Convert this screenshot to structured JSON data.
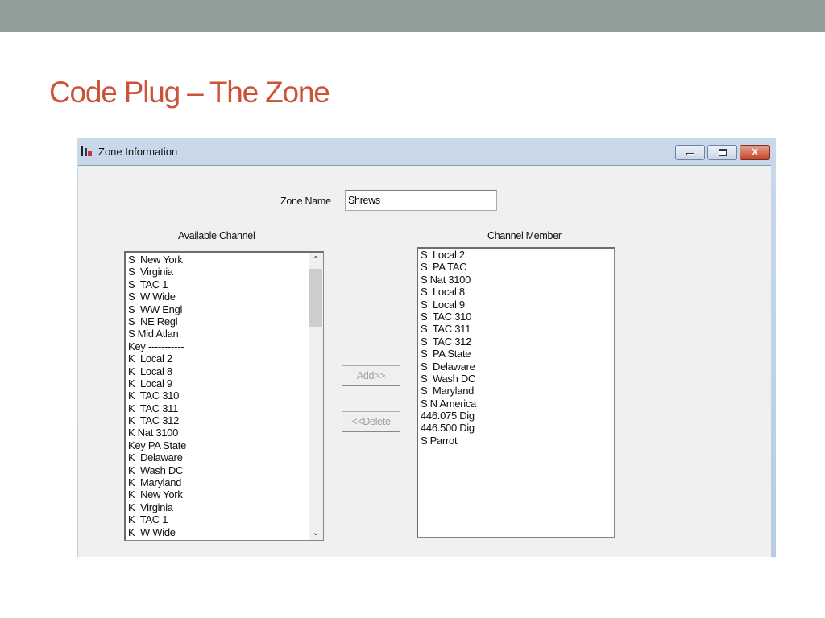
{
  "slide": {
    "title": "Code Plug – The Zone"
  },
  "window": {
    "title": "Zone Information",
    "icon": "app-icon",
    "controls": {
      "minimize": "minimize-icon",
      "maximize": "maximize-icon",
      "close": "X"
    }
  },
  "form": {
    "zone_name_label": "Zone Name",
    "zone_name_value": "Shrews",
    "available_label": "Available Channel",
    "member_label": "Channel Member",
    "add_label": "Add>>",
    "delete_label": "<<Delete",
    "buttons_enabled": false
  },
  "available_channels": [
    "S  New York",
    "S  Virginia",
    "S  TAC 1",
    "S  W Wide",
    "S  WW Engl",
    "S  NE Regl",
    "S Mid Atlan",
    "Key -----------",
    "K  Local 2",
    "K  Local 8",
    "K  Local 9",
    "K  TAC 310",
    "K  TAC 311",
    "K  TAC 312",
    "K Nat 3100",
    "Key PA State",
    "K  Delaware",
    "K  Wash DC",
    "K  Maryland",
    "K  New York",
    "K  Virginia",
    "K  TAC 1",
    "K  W Wide"
  ],
  "channel_members": [
    "S  Local 2",
    "S  PA TAC",
    "S Nat 3100",
    "S  Local 8",
    "S  Local 9",
    "S  TAC 310",
    "S  TAC 311",
    "S  TAC 312",
    "S  PA State",
    "S  Delaware",
    "S  Wash DC",
    "S  Maryland",
    "S N America",
    "446.075 Dig",
    "446.500 Dig",
    "S Parrot"
  ],
  "colors": {
    "title": "#cc5238",
    "topbar": "#909f98",
    "close_button": "#c3432a"
  }
}
